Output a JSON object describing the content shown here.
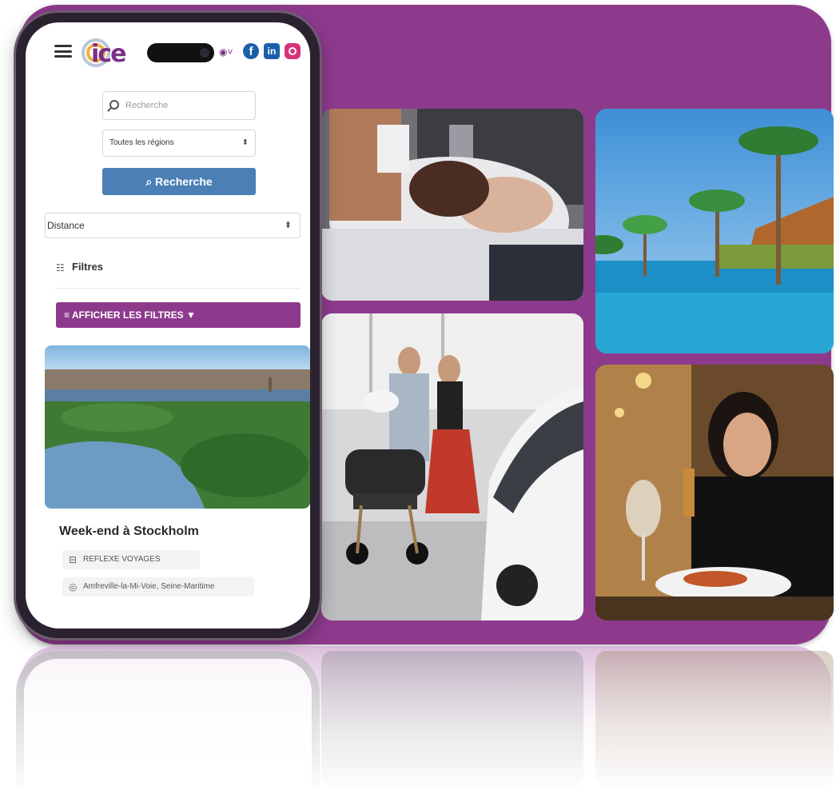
{
  "brand": {
    "logo_text": "ice",
    "purple": "#8d3a8d",
    "blue_button": "#4b7fb6"
  },
  "header": {
    "icons": [
      "menu-icon",
      "user-icon",
      "facebook-icon",
      "linkedin-icon",
      "instagram-icon"
    ],
    "fb_glyph": "f",
    "in_glyph": "in",
    "user_glyph": "◉˅"
  },
  "search": {
    "placeholder": "Recherche",
    "region_value": "Toutes les régions",
    "button_label": "⌕ Recherche"
  },
  "distance": {
    "value": "Distance"
  },
  "filters": {
    "label": "Filtres",
    "show_button": "≡ AFFICHER LES FILTRES ▼"
  },
  "listing": {
    "title": "Week-end à Stockholm",
    "organizer": "REFLEXE VOYAGES",
    "location": "Amfreville-la-Mi-Voie, Seine-Maritime"
  },
  "photos": [
    "hair-salon-photo",
    "tropical-resort-photo",
    "car-showroom-family-photo",
    "restaurant-dining-photo"
  ]
}
